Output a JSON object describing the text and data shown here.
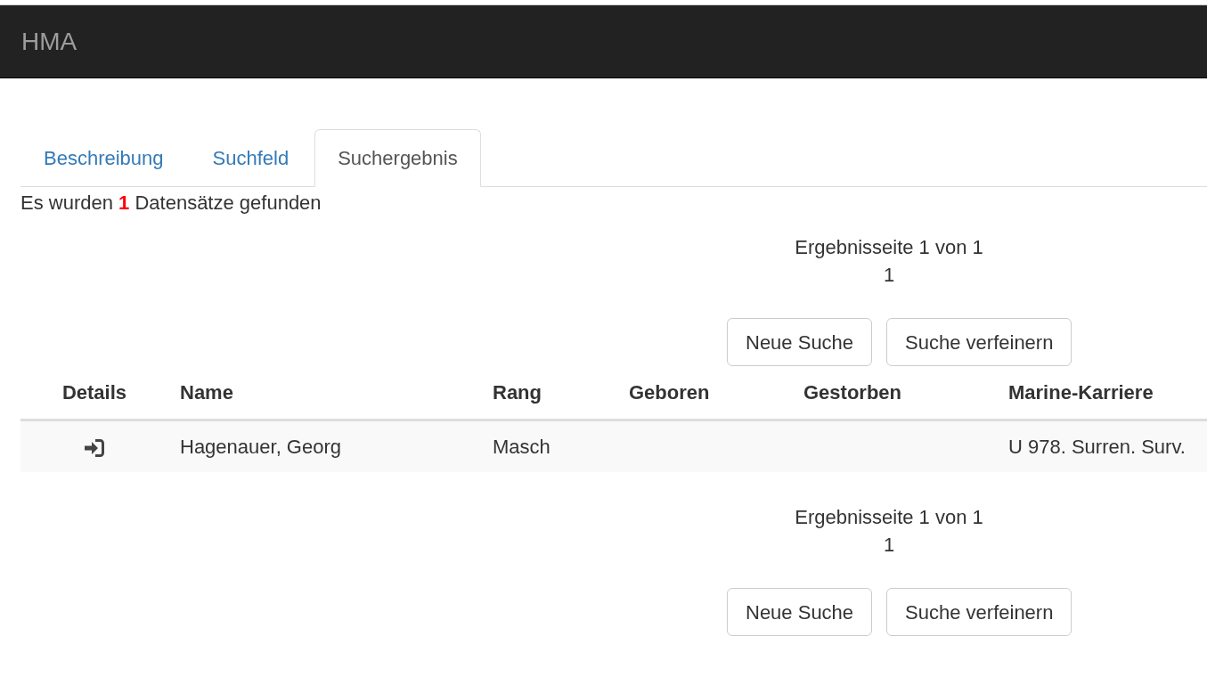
{
  "navbar": {
    "brand": "HMA"
  },
  "tabs": [
    {
      "label": "Beschreibung",
      "selected": false
    },
    {
      "label": "Suchfeld",
      "selected": false
    },
    {
      "label": "Suchergebnis",
      "selected": true
    }
  ],
  "result_summary": "Es wurden **1** Datensätze gefunden",
  "pager_top": {
    "page_info": "Ergebnisseite 1 von 1",
    "pages": [
      "1"
    ],
    "buttons": [
      "Neue Suche",
      "Suche verfeinern"
    ]
  },
  "table": {
    "columns": [
      "Details",
      "Name",
      "Rang",
      "Geboren",
      "Gestorben",
      "Marine-Karriere"
    ],
    "rows": [
      {
        "name": "Hagenauer, Georg",
        "rank": "Masch",
        "naval_career": "U 978. Surren. Surv."
      }
    ]
  },
  "pager_bottom": {
    "page_info": "Ergebnisseite 1 von 1",
    "pages": [
      "1"
    ],
    "buttons": [
      "Neue Suche",
      "Suche verfeinern"
    ]
  }
}
